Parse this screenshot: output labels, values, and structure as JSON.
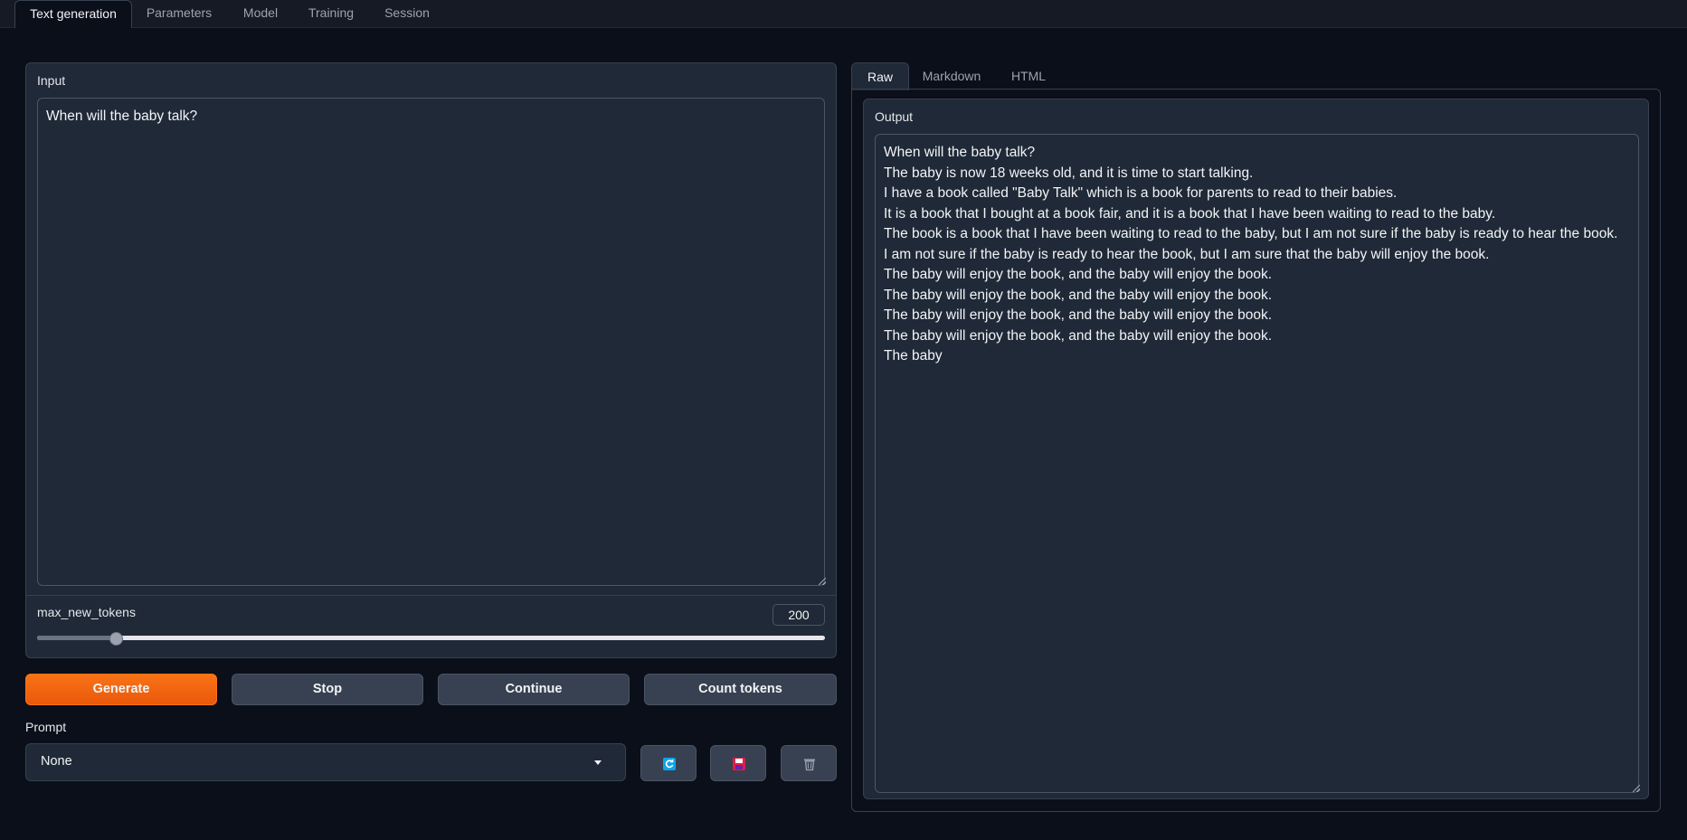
{
  "top_tabs": [
    "Text generation",
    "Parameters",
    "Model",
    "Training",
    "Session"
  ],
  "input": {
    "label": "Input",
    "value": "When will the baby talk?"
  },
  "max_new_tokens": {
    "label": "max_new_tokens",
    "value": "200",
    "min": 0,
    "max": 2000,
    "level": 200
  },
  "buttons": {
    "generate": "Generate",
    "stop": "Stop",
    "continue": "Continue",
    "count_tokens": "Count tokens"
  },
  "prompt": {
    "label": "Prompt",
    "selected": "None"
  },
  "prompt_actions": [
    "refresh-icon",
    "save-icon",
    "trash-icon"
  ],
  "output_tabs": [
    "Raw",
    "Markdown",
    "HTML"
  ],
  "output": {
    "label": "Output",
    "value": "When will the baby talk?\nThe baby is now 18 weeks old, and it is time to start talking.\nI have a book called \"Baby Talk\" which is a book for parents to read to their babies.\nIt is a book that I bought at a book fair, and it is a book that I have been waiting to read to the baby.\nThe book is a book that I have been waiting to read to the baby, but I am not sure if the baby is ready to hear the book.\nI am not sure if the baby is ready to hear the book, but I am sure that the baby will enjoy the book.\nThe baby will enjoy the book, and the baby will enjoy the book.\nThe baby will enjoy the book, and the baby will enjoy the book.\nThe baby will enjoy the book, and the baby will enjoy the book.\nThe baby will enjoy the book, and the baby will enjoy the book.\nThe baby"
  },
  "colors": {
    "background": "#0b0f19",
    "panel": "#1f2937",
    "accent": "#f97316",
    "save_icon": "#e11d48",
    "refresh_icon": "#0ea5e9"
  }
}
